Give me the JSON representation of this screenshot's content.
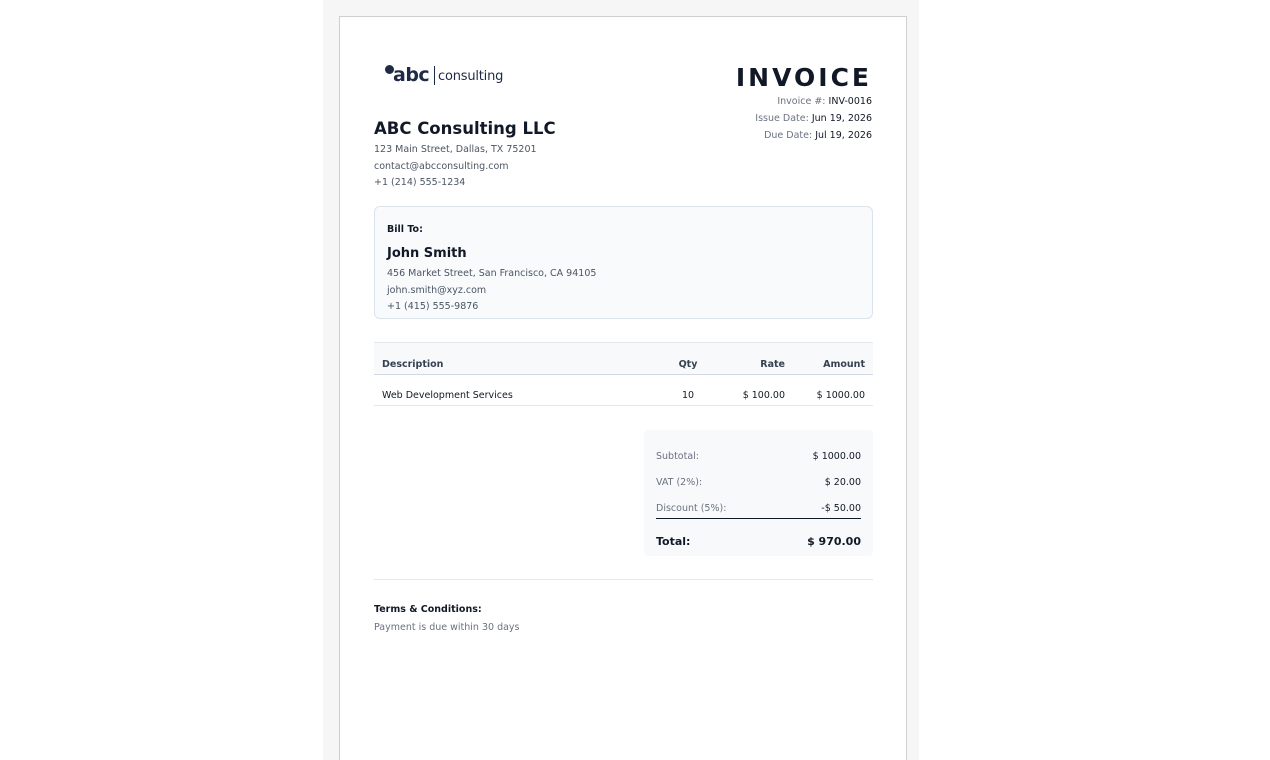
{
  "logo": {
    "brand": "abc",
    "tagline": "consulting"
  },
  "invoice": {
    "title": "INVOICE",
    "number_label": "Invoice #:",
    "number": "INV-0016",
    "issue_label": "Issue Date:",
    "issue_date": "Jun 19, 2026",
    "due_label": "Due Date:",
    "due_date": "Jul 19, 2026"
  },
  "company": {
    "name": "ABC Consulting LLC",
    "address": "123 Main Street, Dallas, TX 75201",
    "email": "contact@abcconsulting.com",
    "phone": "+1 (214) 555-1234"
  },
  "bill_to": {
    "label": "Bill To:",
    "name": "John Smith",
    "address": "456 Market Street, San Francisco, CA 94105",
    "email": "john.smith@xyz.com",
    "phone": "+1 (415) 555-9876"
  },
  "items": {
    "headers": {
      "description": "Description",
      "qty": "Qty",
      "rate": "Rate",
      "amount": "Amount"
    },
    "rows": [
      {
        "description": "Web Development Services",
        "qty": "10",
        "rate": "$ 100.00",
        "amount": "$ 1000.00"
      }
    ]
  },
  "totals": {
    "subtotal_label": "Subtotal:",
    "subtotal": "$ 1000.00",
    "vat_label": "VAT (2%):",
    "vat": "$ 20.00",
    "discount_label": "Discount (5%):",
    "discount": "-$ 50.00",
    "total_label": "Total:",
    "total": "$ 970.00"
  },
  "terms": {
    "title": "Terms & Conditions:",
    "text": "Payment is due within 30 days"
  },
  "colors": {
    "brand": "#1f2a44",
    "text": "#111827",
    "muted": "#6b7280",
    "panel": "#f8fafc"
  }
}
